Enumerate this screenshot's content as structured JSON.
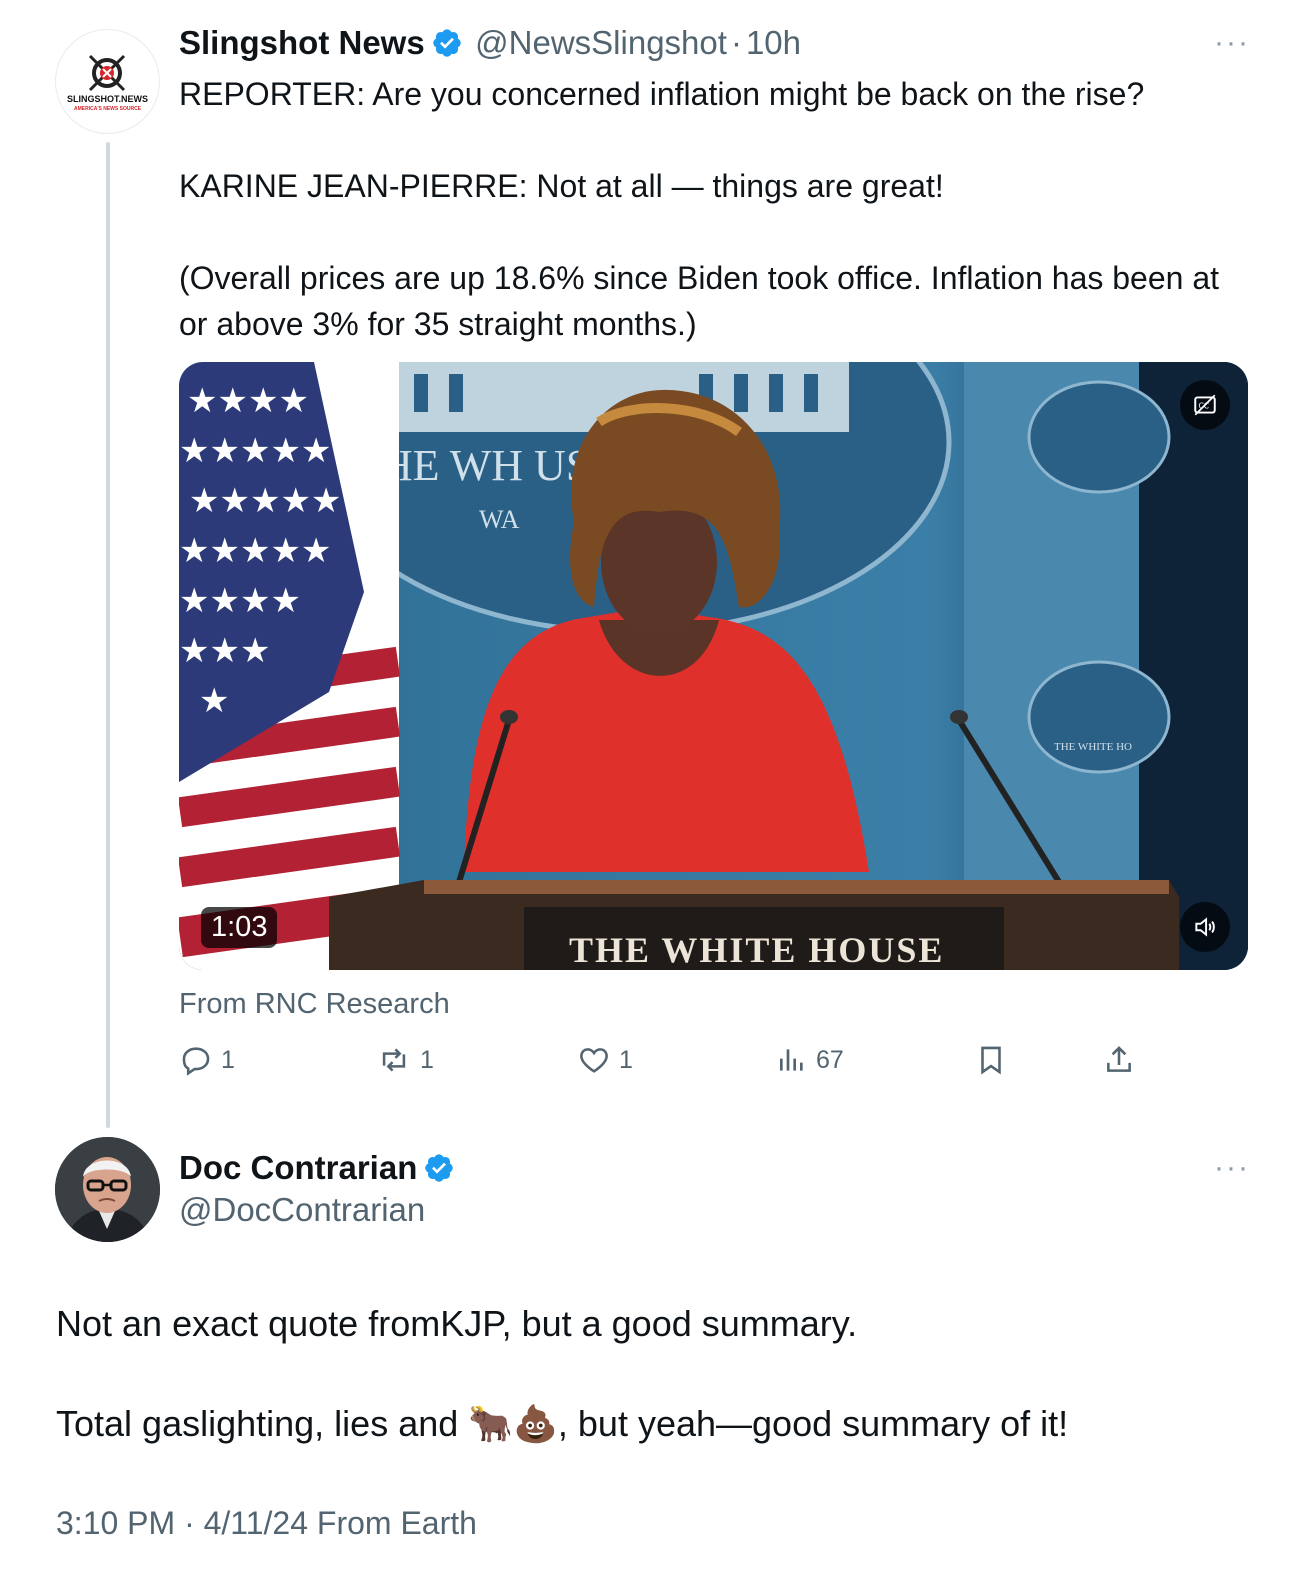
{
  "quoted_tweet": {
    "author_name": "Slingshot News",
    "handle": "@NewsSlingshot",
    "dot": "·",
    "time": "10h",
    "more": "···",
    "avatar_logo": {
      "line1": "SLINGSHOT.NEWS",
      "line2": "AMERICA'S NEWS SOURCE"
    },
    "text": "REPORTER: Are you concerned inflation might be back on the rise?\n\nKARINE JEAN-PIERRE: Not at all — things are great!\n\n(Overall prices are up 18.6% since Biden took office. Inflation has been at or above 3% for 35 straight months.)",
    "media": {
      "duration": "1:03",
      "sign_top": "THE WH        USE",
      "sign_sub": "WA",
      "podium_label": "THE WHITE HOUSE",
      "seal_label": "THE WHITE HO"
    },
    "source": "From RNC Research",
    "actions": {
      "replies": "1",
      "reposts": "1",
      "likes": "1",
      "views": "67"
    }
  },
  "reply": {
    "author_name": "Doc Contrarian",
    "handle": "@DocContrarian",
    "more": "···",
    "line1": "Not an exact quote fromKJP, but a good summary.",
    "line2": "Total gaslighting, lies and 🐂💩, but yeah—good summary of it!",
    "meta": "3:10 PM · 4/11/24 From Earth"
  },
  "colors": {
    "verified": "#1d9bf0",
    "muted": "#536471",
    "thread_line": "#cfd9de"
  }
}
